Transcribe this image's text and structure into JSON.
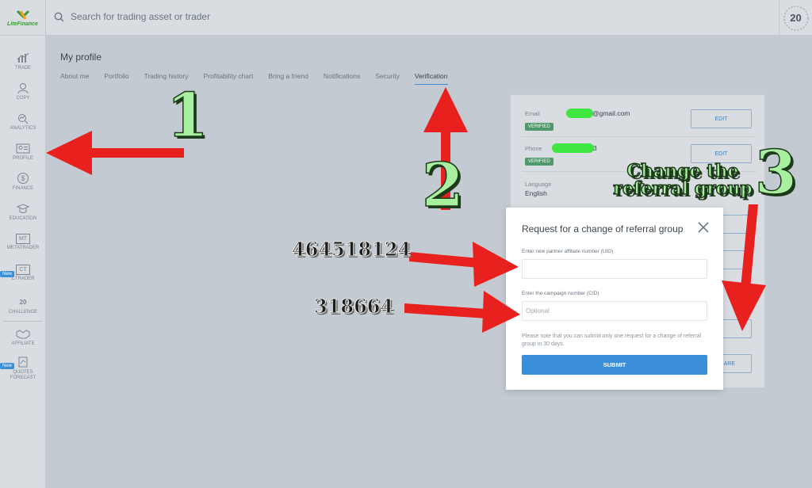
{
  "header": {
    "brand": "LiteFinance",
    "search_placeholder": "Search for trading asset or trader",
    "badge": "20",
    "icons": {
      "logo": "litefinance-logo-icon",
      "search": "search-icon",
      "badge": "anniversary-20-icon"
    }
  },
  "sidebar": {
    "items": [
      {
        "label": "TRADE",
        "icon": "chart-icon"
      },
      {
        "label": "COPY",
        "icon": "copy-person-icon"
      },
      {
        "label": "ANALYTICS",
        "icon": "analytics-icon"
      },
      {
        "label": "PROFILE",
        "icon": "profile-card-icon"
      },
      {
        "label": "FINANCE",
        "icon": "dollar-icon"
      },
      {
        "label": "EDUCATION",
        "icon": "graduation-cap-icon"
      },
      {
        "label": "METATRADER",
        "icon": "mt-icon"
      },
      {
        "label": "CTRADER",
        "icon": "ct-icon",
        "new": "New"
      },
      {
        "label": "CHALLENGE",
        "icon": "laurel-icon"
      },
      {
        "label": "AFFILIATE",
        "icon": "handshake-icon"
      },
      {
        "label": "QUOTES FORECAST",
        "icon": "forecast-icon",
        "new": "New"
      }
    ],
    "ct_text": "CT",
    "mt_text": "MT",
    "challenge_text": "20"
  },
  "profile": {
    "title": "My profile",
    "tabs": [
      {
        "label": "About me"
      },
      {
        "label": "Portfolio"
      },
      {
        "label": "Trading history"
      },
      {
        "label": "Profitability chart"
      },
      {
        "label": "Bring a friend"
      },
      {
        "label": "Notifications"
      },
      {
        "label": "Security"
      },
      {
        "label": "Verification",
        "active": true
      }
    ]
  },
  "verification": {
    "email": {
      "label": "Email",
      "value": "@gmail.com",
      "status": "VERIFIED",
      "action": "EDIT"
    },
    "phone": {
      "label": "Phone",
      "value": "3",
      "status": "VERIFIED",
      "action": "EDIT"
    },
    "language": {
      "label": "Language",
      "value": "English"
    },
    "hidden_buttons": [
      "IT",
      "IT",
      "IT",
      "ARE"
    ]
  },
  "modal": {
    "title": "Request for a change of referral group",
    "uid_label": "Enter new partner affiliate number (UID)",
    "uid_value": "",
    "cid_label": "Enter the campaign number (CID)",
    "cid_placeholder": "Optional",
    "note": "Please note that you can submit only one request for a change of referral group in 30 days.",
    "submit": "SUBMIT"
  },
  "annotations": {
    "step1": "1",
    "step2": "2",
    "step3": "3",
    "step3_caption": "Change the referral group",
    "uid_example": "464518124",
    "cid_example": "318664",
    "arrow_color": "#e8201e",
    "highlight_color": "#3fe63f"
  }
}
